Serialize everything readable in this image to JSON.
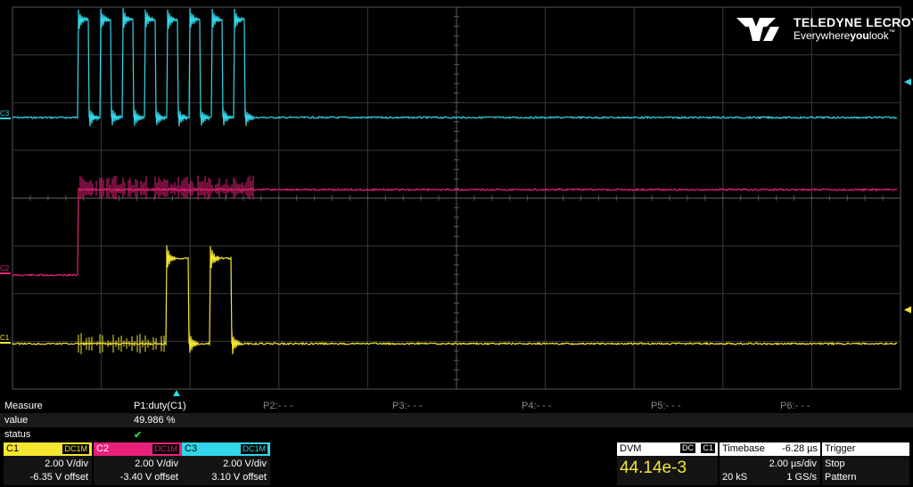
{
  "logo": {
    "brand": "TELEDYNE LECROY",
    "tagline_pre": "Everywhere",
    "tagline_bold": "you",
    "tagline_post": "look",
    "tm": "™"
  },
  "traces": {
    "c3": {
      "label": "C3",
      "color": "#33d6e8"
    },
    "c2": {
      "label": "C2",
      "color": "#e8207a"
    },
    "c1": {
      "label": "C1",
      "color": "#f5e632"
    }
  },
  "measure": {
    "headers": [
      "Measure",
      "P1:duty(C1)",
      "P2:- - -",
      "P3:- - -",
      "P4:- - -",
      "P5:- - -",
      "P6:- - -"
    ],
    "value_label": "value",
    "value": "49.986 %",
    "status_label": "status",
    "status": "✔"
  },
  "channels": [
    {
      "name": "C1",
      "coupling": "DC1M",
      "vdiv": "2.00 V/div",
      "offset": "-6.35 V offset",
      "color": "#f5e632"
    },
    {
      "name": "C2",
      "coupling": "DC1M",
      "vdiv": "2.00 V/div",
      "offset": "-3.40 V offset",
      "color": "#e8207a"
    },
    {
      "name": "C3",
      "coupling": "DC1M",
      "vdiv": "2.00 V/div",
      "offset": "3.10 V offset",
      "color": "#33d6e8"
    }
  ],
  "dvm": {
    "title": "DVM",
    "coupling": "DC",
    "channel": "C1",
    "reading": "44.14e-3"
  },
  "timebase": {
    "title": "Timebase",
    "delay": "-6.28 µs",
    "tdiv": "2.00 µs/div",
    "samples": "20 kS",
    "rate": "1 GS/s"
  },
  "trigger": {
    "title": "Trigger",
    "mode": "Stop",
    "type": "Pattern"
  }
}
